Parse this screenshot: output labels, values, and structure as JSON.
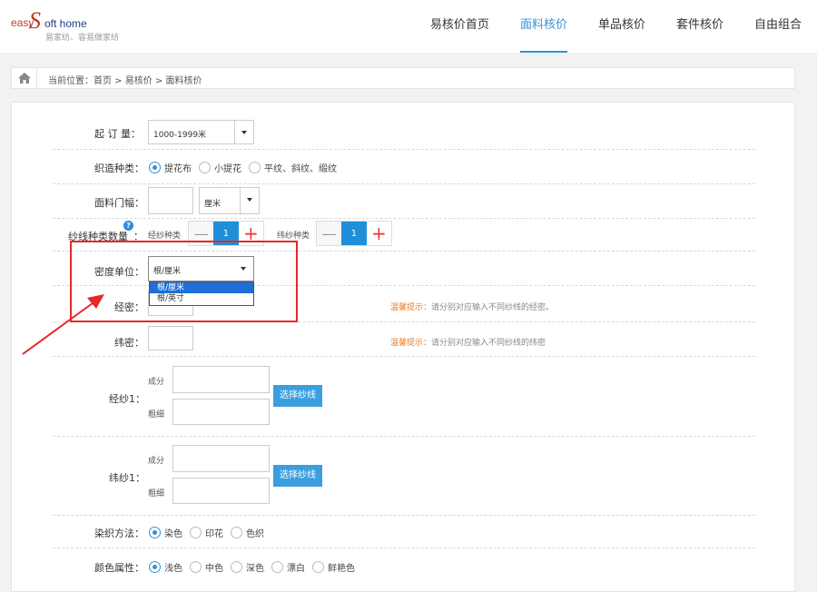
{
  "logo": {
    "easy": "easy",
    "s": "S",
    "soft_home": "oft home",
    "slogan": "易家纺、容易做家纺"
  },
  "nav": [
    "易核价首页",
    "面料核价",
    "单品核价",
    "套件核价",
    "自由组合"
  ],
  "breadcrumb": "当前位置：首页 > 易核价 > 面料核价",
  "form": {
    "moq": {
      "label": "起 订 量：",
      "value": "1000-1999米"
    },
    "weave": {
      "label": "织造种类：",
      "options": [
        "提花布",
        "小提花",
        "平纹、斜纹、缎纹"
      ],
      "selected": 0
    },
    "width": {
      "label": "面料门幅：",
      "unit": "厘米"
    },
    "yarn_count": {
      "label": "纱线种类数量",
      "help": "?",
      "colon": "：",
      "warp_label": "经纱种类",
      "warp_value": "1",
      "weft_label": "纬纱种类",
      "weft_value": "1",
      "minus": "—",
      "plus": "+"
    },
    "density_unit": {
      "label": "密度单位：",
      "value": "根/厘米",
      "options": [
        "根/厘米",
        "根/英寸"
      ],
      "highlighted": 0
    },
    "warp_density": {
      "label": "经密：",
      "tip_prefix": "温馨提示：",
      "tip_text": "请分别对应输入不同纱线的经密。"
    },
    "weft_density": {
      "label": "纬密：",
      "tip_prefix": "温馨提示：",
      "tip_text": "请分别对应输入不同纱线的纬密"
    },
    "warp_yarn": {
      "label": "经纱1：",
      "comp_label": "成分",
      "fine_label": "粗细",
      "button": "选择纱线"
    },
    "weft_yarn": {
      "label": "纬纱1：",
      "comp_label": "成分",
      "fine_label": "粗细",
      "button": "选择纱线"
    },
    "dyeing": {
      "label": "染织方法：",
      "options": [
        "染色",
        "印花",
        "色织"
      ],
      "selected": 0
    },
    "color": {
      "label": "颜色属性：",
      "options": [
        "浅色",
        "中色",
        "深色",
        "漂白",
        "鲜艳色"
      ],
      "selected": 0
    }
  },
  "colors": {
    "accent": "#3592d1",
    "annotation": "#e8262b",
    "tip": "#f07b22"
  }
}
